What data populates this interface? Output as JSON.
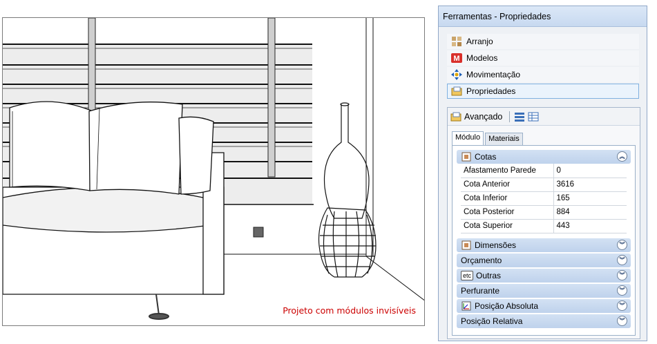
{
  "viewport": {
    "caption": "Projeto com módulos invisíveis"
  },
  "panel": {
    "title": "Ferramentas - Propriedades",
    "nav": [
      {
        "label": "Arranjo",
        "icon": "arrange-grid-icon",
        "active": false
      },
      {
        "label": "Modelos",
        "icon": "models-m-icon",
        "active": false
      },
      {
        "label": "Movimentação",
        "icon": "move-arrows-icon",
        "active": false
      },
      {
        "label": "Propriedades",
        "icon": "properties-folder-icon",
        "active": true
      }
    ],
    "advanced": {
      "label": "Avançado",
      "tabs": [
        {
          "label": "Módulo",
          "active": true
        },
        {
          "label": "Materiais",
          "active": false
        }
      ],
      "sections": [
        {
          "label": "Cotas",
          "icon": "dimension-box-icon",
          "expanded": true,
          "rows": [
            {
              "key": "Afastamento Parede",
              "value": "0"
            },
            {
              "key": "Cota Anterior",
              "value": "3616"
            },
            {
              "key": "Cota Inferior",
              "value": "165"
            },
            {
              "key": "Cota Posterior",
              "value": "884"
            },
            {
              "key": "Cota Superior",
              "value": "443"
            }
          ]
        },
        {
          "label": "Dimensões",
          "icon": "dimension-box-icon",
          "expanded": false
        },
        {
          "label": "Orçamento",
          "icon": "",
          "expanded": false
        },
        {
          "label": "Outras",
          "icon": "etc-icon",
          "expanded": false,
          "icon_text": "etc"
        },
        {
          "label": "Perfurante",
          "icon": "",
          "expanded": false
        },
        {
          "label": "Posição Absoluta",
          "icon": "position-axes-icon",
          "expanded": false
        },
        {
          "label": "Posição Relativa",
          "icon": "",
          "expanded": false
        }
      ]
    }
  },
  "colors": {
    "accent": "#bfd2ec",
    "caption_red": "#cc0000",
    "active_border": "#7fb0e0"
  }
}
